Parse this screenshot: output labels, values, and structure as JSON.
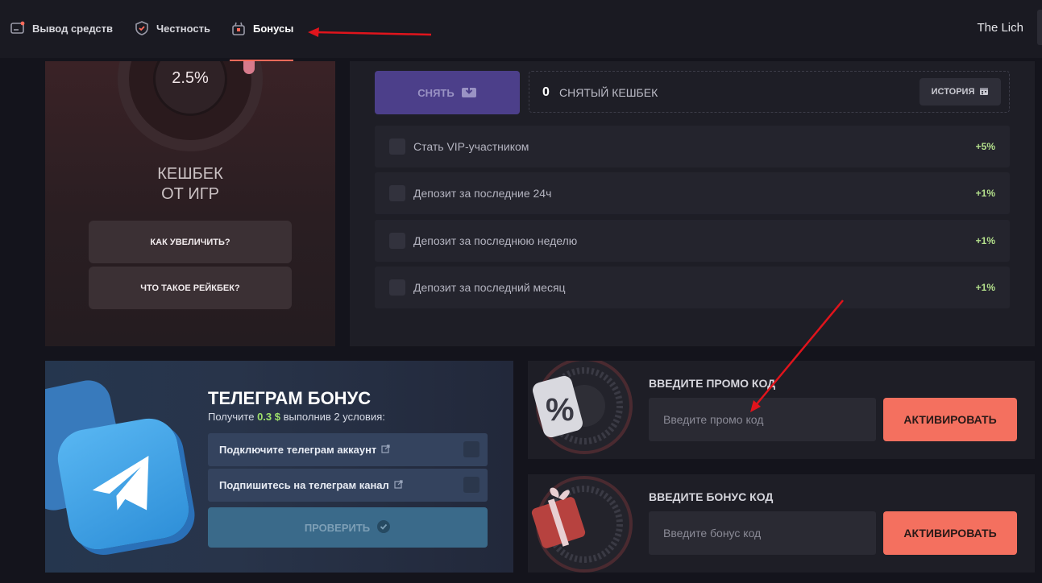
{
  "nav": {
    "items": [
      {
        "label": "Вывод средств",
        "icon": "wallet-icon"
      },
      {
        "label": "Честность",
        "icon": "shield-icon"
      },
      {
        "label": "Бонусы",
        "icon": "gift-icon"
      }
    ],
    "active": "Бонусы",
    "user_name": "The Lich",
    "accent_color": "#ff6a5a"
  },
  "cashback": {
    "percent": "2.5%",
    "title_line1": "КЕШБЕК",
    "title_line2": "ОТ ИГР",
    "how_increase": "КАК УВЕЛИЧИТЬ?",
    "what_rakeback": "ЧТО ТАКОЕ РЕЙКБЕК?",
    "withdraw_label": "СНЯТЬ",
    "withdrawn_amount": "0",
    "withdrawn_label": "СНЯТЫЙ КЕШБЕК",
    "history_label": "ИСТОРИЯ",
    "conditions": [
      {
        "label": "Стать VIP-участником",
        "bonus": "+5%"
      },
      {
        "label": "Депозит за последние 24ч",
        "bonus": "+1%"
      },
      {
        "label": "Депозит за последнюю неделю",
        "bonus": "+1%"
      },
      {
        "label": "Депозит за последний месяц",
        "bonus": "+1%"
      }
    ]
  },
  "telegram": {
    "title": "ТЕЛЕГРАМ БОНУС",
    "subtitle_prefix": "Получите",
    "amount": "0.3 $",
    "subtitle_suffix": "выполнив 2 условия:",
    "tasks": [
      {
        "label": "Подключите телеграм аккаунт"
      },
      {
        "label": "Подпишитесь на телеграм канал"
      }
    ],
    "check_label": "ПРОВЕРИТЬ"
  },
  "promo": {
    "title": "ВВЕДИТЕ ПРОМО КОД",
    "placeholder": "Введите промо код",
    "button": "АКТИВИРОВАТЬ"
  },
  "bonus_code": {
    "title": "ВВЕДИТЕ БОНУС КОД",
    "placeholder": "Введите бонус код",
    "button": "АКТИВИРОВАТЬ"
  }
}
